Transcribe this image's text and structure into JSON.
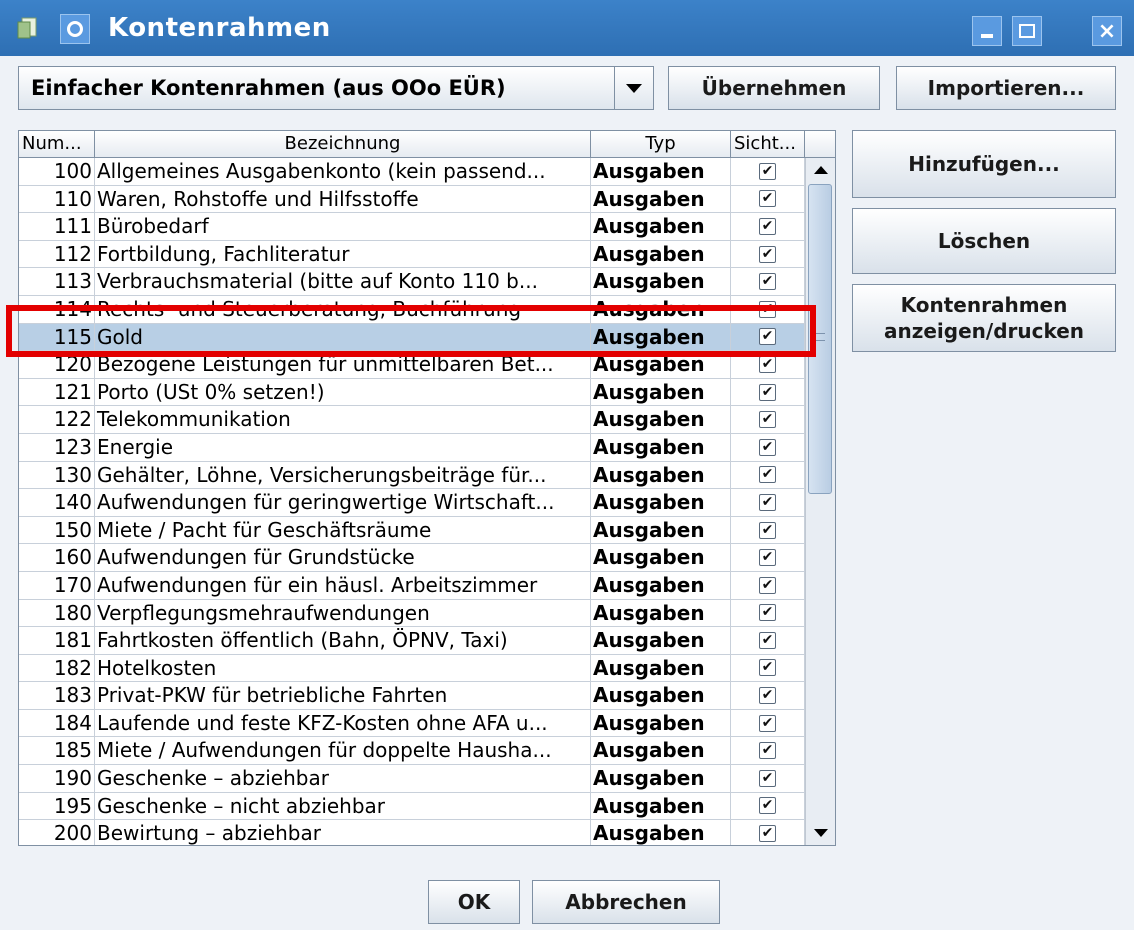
{
  "window": {
    "title": "Kontenrahmen",
    "minimize_icon": "minimize-icon",
    "maximize_icon": "maximize-icon",
    "close_label": "×"
  },
  "toolbar": {
    "selected_kontenrahmen": "Einfacher Kontenrahmen (aus OOo EÜR)",
    "uebernehmen_label": "Übernehmen",
    "importieren_label": "Importieren..."
  },
  "side_buttons": {
    "hinzufuegen_label": "Hinzufügen...",
    "loeschen_label": "Löschen",
    "anzeigen_line1": "Kontenrahmen",
    "anzeigen_line2": "anzeigen/drucken"
  },
  "footer": {
    "ok_label": "OK",
    "abbrechen_label": "Abbrechen"
  },
  "table": {
    "columns": [
      "Num...",
      "Bezeichnung",
      "Typ",
      "Sicht..."
    ],
    "check_glyph": "✔",
    "rows": [
      {
        "num": "100",
        "bez": "Allgemeines Ausgabenkonto (kein passend...",
        "typ": "Ausgaben"
      },
      {
        "num": "110",
        "bez": "Waren, Rohstoffe und Hilfsstoffe",
        "typ": "Ausgaben"
      },
      {
        "num": "111",
        "bez": "Bürobedarf",
        "typ": "Ausgaben"
      },
      {
        "num": "112",
        "bez": "Fortbildung, Fachliteratur",
        "typ": "Ausgaben"
      },
      {
        "num": "113",
        "bez": "Verbrauchsmaterial (bitte auf Konto 110 b...",
        "typ": "Ausgaben"
      },
      {
        "num": "114",
        "bez": "Rechts- und Steuerberatung, Buchführung",
        "typ": "Ausgaben"
      },
      {
        "num": "115",
        "bez": "Gold",
        "typ": "Ausgaben"
      },
      {
        "num": "120",
        "bez": "Bezogene Leistungen für unmittelbaren Bet...",
        "typ": "Ausgaben"
      },
      {
        "num": "121",
        "bez": "Porto (USt 0% setzen!)",
        "typ": "Ausgaben"
      },
      {
        "num": "122",
        "bez": "Telekommunikation",
        "typ": "Ausgaben"
      },
      {
        "num": "123",
        "bez": "Energie",
        "typ": "Ausgaben"
      },
      {
        "num": "130",
        "bez": "Gehälter, Löhne, Versicherungsbeiträge für...",
        "typ": "Ausgaben"
      },
      {
        "num": "140",
        "bez": "Aufwendungen für geringwertige Wirtschaft...",
        "typ": "Ausgaben"
      },
      {
        "num": "150",
        "bez": "Miete / Pacht für Geschäftsräume",
        "typ": "Ausgaben"
      },
      {
        "num": "160",
        "bez": "Aufwendungen für Grundstücke",
        "typ": "Ausgaben"
      },
      {
        "num": "170",
        "bez": "Aufwendungen für ein häusl. Arbeitszimmer",
        "typ": "Ausgaben"
      },
      {
        "num": "180",
        "bez": "Verpflegungsmehraufwendungen",
        "typ": "Ausgaben"
      },
      {
        "num": "181",
        "bez": "Fahrtkosten öffentlich (Bahn, ÖPNV, Taxi)",
        "typ": "Ausgaben"
      },
      {
        "num": "182",
        "bez": "Hotelkosten",
        "typ": "Ausgaben"
      },
      {
        "num": "183",
        "bez": "Privat-PKW für betriebliche Fahrten",
        "typ": "Ausgaben"
      },
      {
        "num": "184",
        "bez": "Laufende und feste KFZ-Kosten ohne AFA u...",
        "typ": "Ausgaben"
      },
      {
        "num": "185",
        "bez": "Miete / Aufwendungen für doppelte Hausha...",
        "typ": "Ausgaben"
      },
      {
        "num": "190",
        "bez": "Geschenke – abziehbar",
        "typ": "Ausgaben"
      },
      {
        "num": "195",
        "bez": "Geschenke – nicht abziehbar",
        "typ": "Ausgaben"
      },
      {
        "num": "200",
        "bez": "Bewirtung – abziehbar",
        "typ": "Ausgaben"
      }
    ]
  },
  "colors": {
    "titlebar": "#3c82c9",
    "selection": "#b8cfe5",
    "highlight": "#e30000"
  }
}
